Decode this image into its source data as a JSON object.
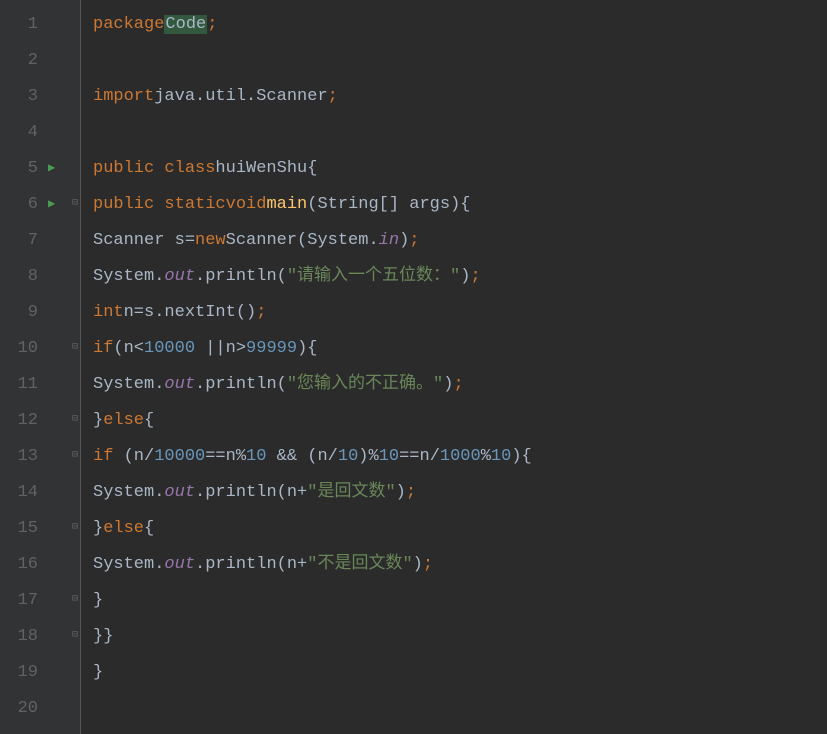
{
  "gutter": {
    "lines": [
      "1",
      "2",
      "3",
      "4",
      "5",
      "6",
      "7",
      "8",
      "9",
      "10",
      "11",
      "12",
      "13",
      "14",
      "15",
      "16",
      "17",
      "18",
      "19",
      "20"
    ],
    "runMarkers": [
      5,
      6
    ],
    "foldMarkers": {
      "6": "open-down",
      "7": "line",
      "10": "open-down",
      "12": "close",
      "13": "open-down",
      "15": "close",
      "17": "close",
      "18": "close"
    }
  },
  "code": {
    "l1": {
      "kw1": "package",
      "id1": "Code",
      "semi": ";"
    },
    "l3": {
      "kw1": "import",
      "id1": "java.util.Scanner",
      "semi": ";"
    },
    "l5": {
      "kw1": "public class",
      "id1": "huiWenShu",
      "brace": "{"
    },
    "l6": {
      "kw1": "public static",
      "kw2": "void",
      "m": "main",
      "p1": "(",
      "t1": "String[] args",
      "p2": ")",
      "brace": "{"
    },
    "l7": {
      "t1": "Scanner s=",
      "kw1": "new",
      "t2": "Scanner(System.",
      "f1": "in",
      "t3": ")",
      "semi": ";"
    },
    "l8": {
      "t1": "System.",
      "f1": "out",
      "t2": ".println(",
      "s1": "\"请输入一个五位数：\"",
      "t3": ")",
      "semi": ";"
    },
    "l9": {
      "kw1": "int",
      "t1": "n=s.nextInt()",
      "semi": ";"
    },
    "l10": {
      "kw1": "if",
      "t1": "(n<",
      "n1": "10000",
      "t2": " ||n>",
      "n2": "99999",
      "t3": "){"
    },
    "l11": {
      "t1": "System.",
      "f1": "out",
      "t2": ".println(",
      "s1": "\"您输入的不正确。\"",
      "t3": ")",
      "semi": ";"
    },
    "l12": {
      "t1": "}",
      "kw1": "else",
      "t2": "{"
    },
    "l13": {
      "kw1": "if",
      "t1": " (n/",
      "n1": "10000",
      "t2": "==n%",
      "n2": "10",
      "t3": " && (n/",
      "n3": "10",
      "t4": ")%",
      "n4": "10",
      "t5": "==n/",
      "n5": "1000",
      "t6": "%",
      "n6": "10",
      "t7": "){"
    },
    "l14": {
      "t1": "System.",
      "f1": "out",
      "t2": ".println(n+",
      "s1": "\"是回文数\"",
      "t3": ")",
      "semi": ";"
    },
    "l15": {
      "t1": "}",
      "kw1": "else",
      "t2": "{"
    },
    "l16": {
      "t1": "System.",
      "f1": "out",
      "t2": ".println(n+",
      "s1": "\"不是回文数\"",
      "t3": ")",
      "semi": ";"
    },
    "l17": {
      "t1": "}"
    },
    "l18": {
      "t1": "}}"
    },
    "l19": {
      "t1": "}"
    }
  }
}
